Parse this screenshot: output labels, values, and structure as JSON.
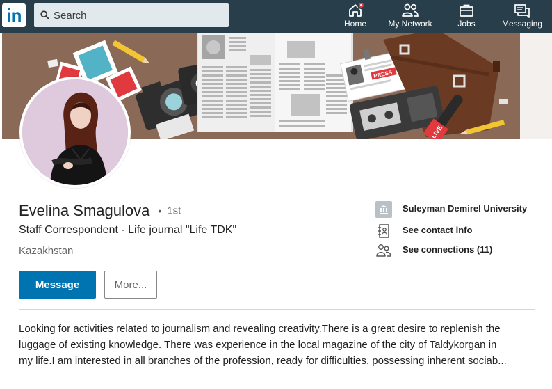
{
  "nav": {
    "logo_text": "in",
    "search_placeholder": "Search",
    "items": [
      {
        "label": "Home",
        "icon": "home-icon",
        "has_badge": true
      },
      {
        "label": "My Network",
        "icon": "network-icon"
      },
      {
        "label": "Jobs",
        "icon": "briefcase-icon"
      },
      {
        "label": "Messaging",
        "icon": "messaging-icon"
      }
    ]
  },
  "profile": {
    "name": "Evelina Smagulova",
    "degree": "1st",
    "headline": "Staff Correspondent - Life journal \"Life TDK\"",
    "location": "Kazakhstan",
    "actions": {
      "message": "Message",
      "more": "More..."
    },
    "side": {
      "education": "Suleyman Demirel University",
      "contact": "See contact info",
      "connections": "See connections (11)"
    },
    "summary_lines": [
      "Looking for activities related to journalism and revealing creativity.There is a great desire to replenish the",
      "luggage of existing knowledge. There was experience in the local magazine of the city of Taldykorgan in",
      "my life.I am interested in all branches of the profession, ready for difficulties, possessing inherent sociab..."
    ],
    "banner_text": {
      "press": "PRESS",
      "live": "LIVE"
    }
  },
  "colors": {
    "nav_bg": "#283e4a",
    "brand_blue": "#0073b1",
    "badge_red": "#e0393e",
    "banner_brown": "#8a6a57"
  }
}
